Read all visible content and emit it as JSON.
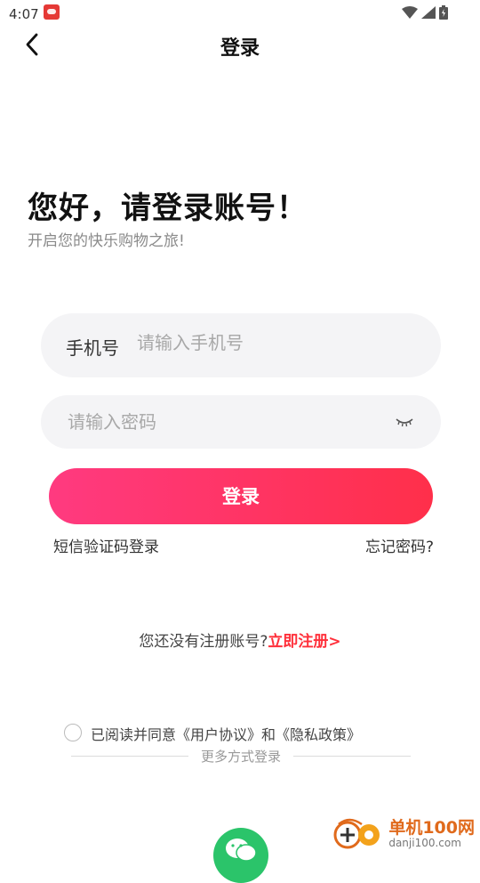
{
  "status_bar": {
    "time": "4:07"
  },
  "header": {
    "title": "登录"
  },
  "greeting": {
    "title": "您好，请登录账号！",
    "subtitle": "开启您的快乐购物之旅!"
  },
  "form": {
    "phone_label": "手机号",
    "phone_placeholder": "请输入手机号",
    "password_placeholder": "请输入密码",
    "login_label": "登录",
    "sms_login": "短信验证码登录",
    "forgot_password": "忘记密码?"
  },
  "register": {
    "prompt": "您还没有注册账号?",
    "link": "立即注册>"
  },
  "agreement": {
    "text": "已阅读并同意《用户协议》和《隐私政策》"
  },
  "more": {
    "label": "更多方式登录"
  },
  "watermark": {
    "name": "单机100网",
    "url": "danji100.com"
  },
  "colors": {
    "accent_start": "#ff3a80",
    "accent_end": "#ff2f4a",
    "register_link": "#ff2f3a",
    "wechat": "#2bc46a"
  }
}
